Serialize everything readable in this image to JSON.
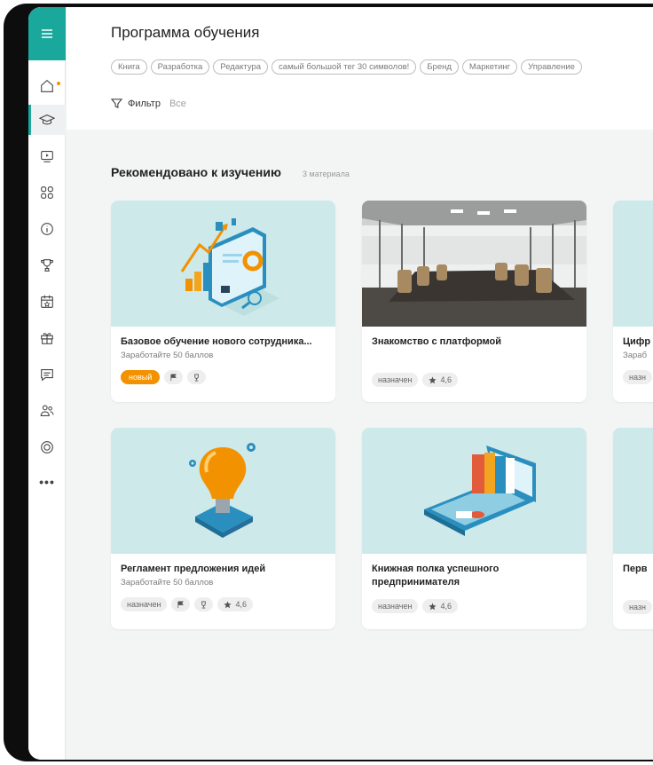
{
  "header": {
    "title": "Программа обучения",
    "tags": [
      "Книга",
      "Разработка",
      "Редактура",
      "самый большой тег 30 символов!",
      "Бренд",
      "Маркетинг",
      "Управление"
    ],
    "filter_label": "Фильтр",
    "filter_value": "Все"
  },
  "section": {
    "title": "Рекомендовано к изучению",
    "count": "3 материала"
  },
  "cards": [
    {
      "title": "Базовое обучение нового сотрудника...",
      "subtitle": "Заработайте 50 баллов",
      "badge": "новый"
    },
    {
      "title": "Знакомство с платформой",
      "status": "назначен",
      "rating": "4,6"
    },
    {
      "title": "Цифр",
      "subtitle": "Зараб",
      "status": "назн"
    },
    {
      "title": "Регламент предложения идей",
      "subtitle": "Заработайте 50 баллов",
      "status": "назначен",
      "rating": "4,6"
    },
    {
      "title": "Книжная полка успешного предпринимателя",
      "status": "назначен",
      "rating": "4,6"
    },
    {
      "title": "Перв",
      "status": "назн"
    }
  ],
  "colors": {
    "accent": "#1aa89d",
    "badge_new": "#f39200",
    "card_image_bg": "#cde9ea"
  },
  "icons": {
    "sidebar": [
      "menu-icon",
      "home-icon",
      "graduation-cap-icon",
      "video-icon",
      "apps-icon",
      "info-icon",
      "trophy-icon",
      "calendar-star-icon",
      "gift-icon",
      "chat-icon",
      "users-icon",
      "lifebuoy-icon",
      "more-icon"
    ],
    "chips": [
      "flag-icon",
      "trophy-icon",
      "star-icon"
    ]
  }
}
